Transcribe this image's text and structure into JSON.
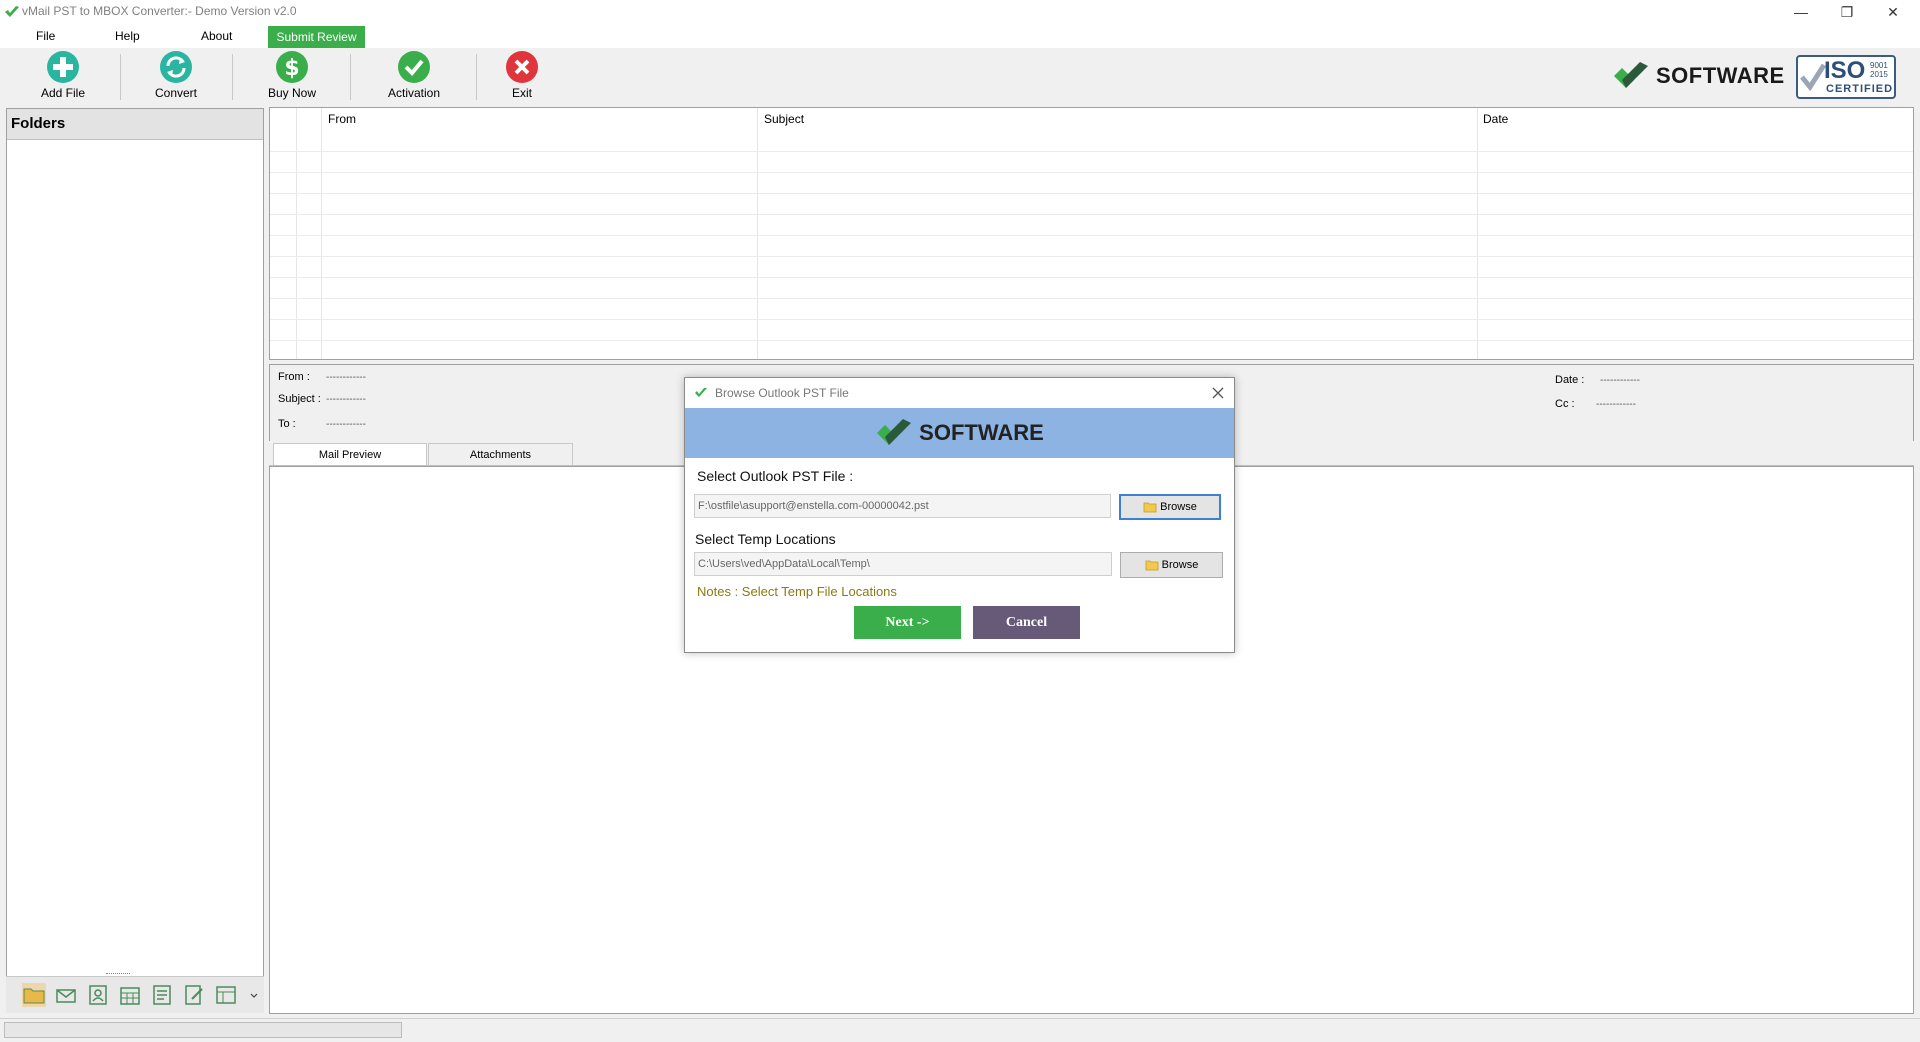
{
  "window": {
    "title": "vMail PST to MBOX Converter:- Demo Version v2.0",
    "controls": {
      "minimize": "—",
      "restore": "❐",
      "close": "✕"
    }
  },
  "menu": {
    "items": [
      "File",
      "Help",
      "About"
    ],
    "submit_review": "Submit Review"
  },
  "toolbar": {
    "add_file": "Add File",
    "convert": "Convert",
    "buy_now": "Buy Now",
    "activation": "Activation",
    "exit": "Exit"
  },
  "brand": {
    "word": "SOFTWARE",
    "iso_text": "ISO",
    "iso_years": [
      "9001",
      "2015"
    ],
    "iso_certified": "CERTIFIED"
  },
  "folders": {
    "title": "Folders"
  },
  "grid": {
    "columns": [
      "From",
      "Subject",
      "Date"
    ]
  },
  "info": {
    "from_label": "From :",
    "subject_label": "Subject :",
    "to_label": "To :",
    "date_label": "Date :",
    "cc_label": "Cc :",
    "placeholder": "------------"
  },
  "tabs": [
    "Mail Preview",
    "Attachments"
  ],
  "dialog": {
    "title": "Browse Outlook PST File",
    "banner_word": "SOFTWARE",
    "pst_label": "Select Outlook PST File :",
    "pst_value": "F:\\ostfile\\asupport@enstella.com-00000042.pst",
    "temp_label": "Select Temp Locations",
    "temp_value": "C:\\Users\\ved\\AppData\\Local\\Temp\\",
    "browse": "Browse",
    "notes": "Notes :  Select Temp File Locations",
    "next": "Next  ->",
    "cancel": "Cancel"
  },
  "colors": {
    "accent_green": "#3aae4a",
    "cancel_purple": "#665a78",
    "banner_blue": "#8db3e2",
    "notes_gold": "#8a7a10"
  }
}
